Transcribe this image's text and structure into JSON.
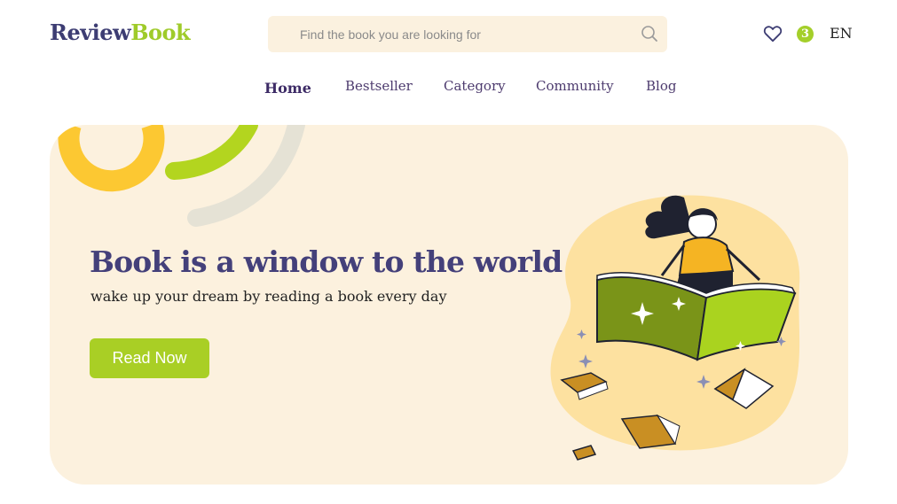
{
  "header": {
    "logo_part1": "Review",
    "logo_part2": "Book",
    "search_placeholder": "Find the book you are looking for",
    "cart_count": "3",
    "language": "EN",
    "icons": [
      "search-icon",
      "heart-icon"
    ]
  },
  "nav": {
    "items": [
      {
        "label": "Home",
        "active": true
      },
      {
        "label": "Bestseller",
        "active": false
      },
      {
        "label": "Category",
        "active": false
      },
      {
        "label": "Community",
        "active": false
      },
      {
        "label": "Blog",
        "active": false
      }
    ]
  },
  "hero": {
    "title": "Book is a window to the world",
    "subtitle": "wake up your dream by reading a book every day",
    "button_label": "Read Now"
  },
  "colors": {
    "brand_dark": "#3d3d73",
    "brand_green": "#9fcb2a",
    "hero_bg": "#fcf1de",
    "button": "#a9cf25",
    "search_bg": "#fbf1df"
  }
}
